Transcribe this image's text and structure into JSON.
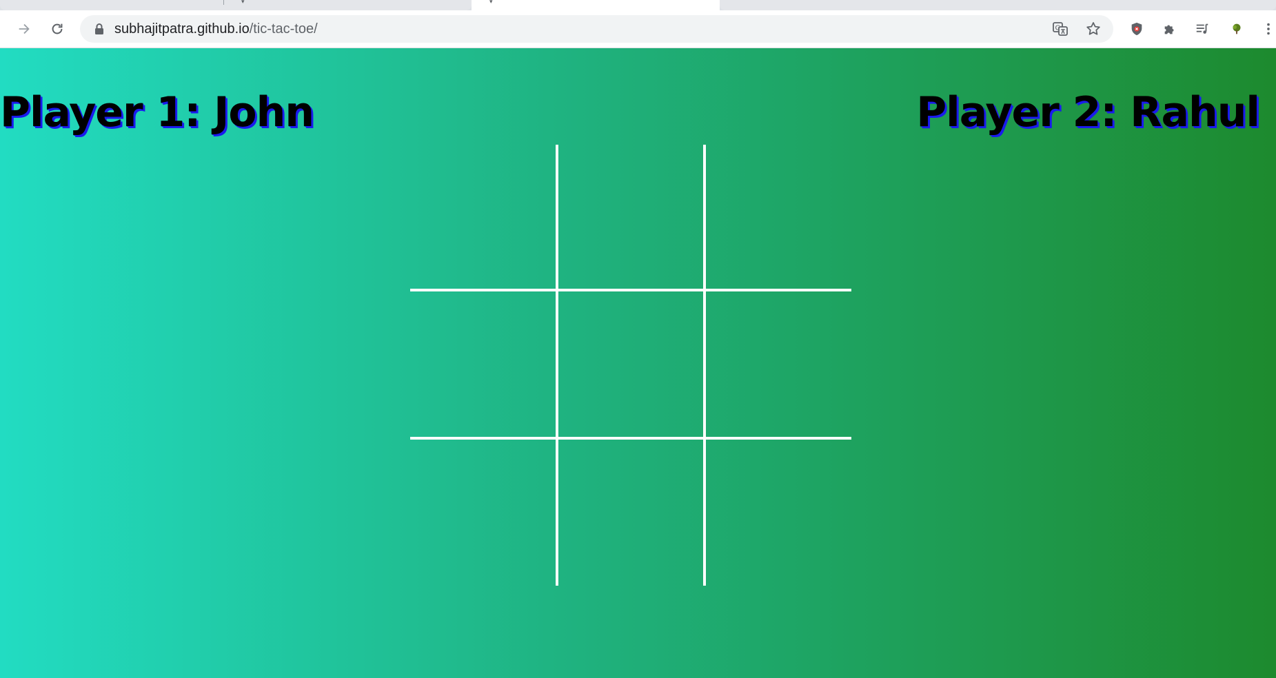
{
  "browser": {
    "url_host": "subhajitpatra.github.io",
    "url_path": "/tic-tac-toe/"
  },
  "icons": {
    "forward": "forward-arrow-icon",
    "reload": "reload-icon",
    "lock": "lock-icon",
    "translate": "translate-icon",
    "bookmark": "star-icon",
    "shield_extension": "shield-extension-icon",
    "extensions": "puzzle-icon",
    "media": "media-queue-icon",
    "profile_extension": "tree-extension-icon",
    "menu": "kebab-menu-icon"
  },
  "game": {
    "player1": "Player 1: John",
    "player2": "Player 2: Rahul",
    "cells": [
      "",
      "",
      "",
      "",
      "",
      "",
      "",
      "",
      ""
    ]
  },
  "colors": {
    "gradient_start": "#22dcc2",
    "gradient_end": "#1d8a2e",
    "grid_lines": "#ffffff",
    "player_text": "#000000",
    "player_shadow": "#1a1aee"
  }
}
